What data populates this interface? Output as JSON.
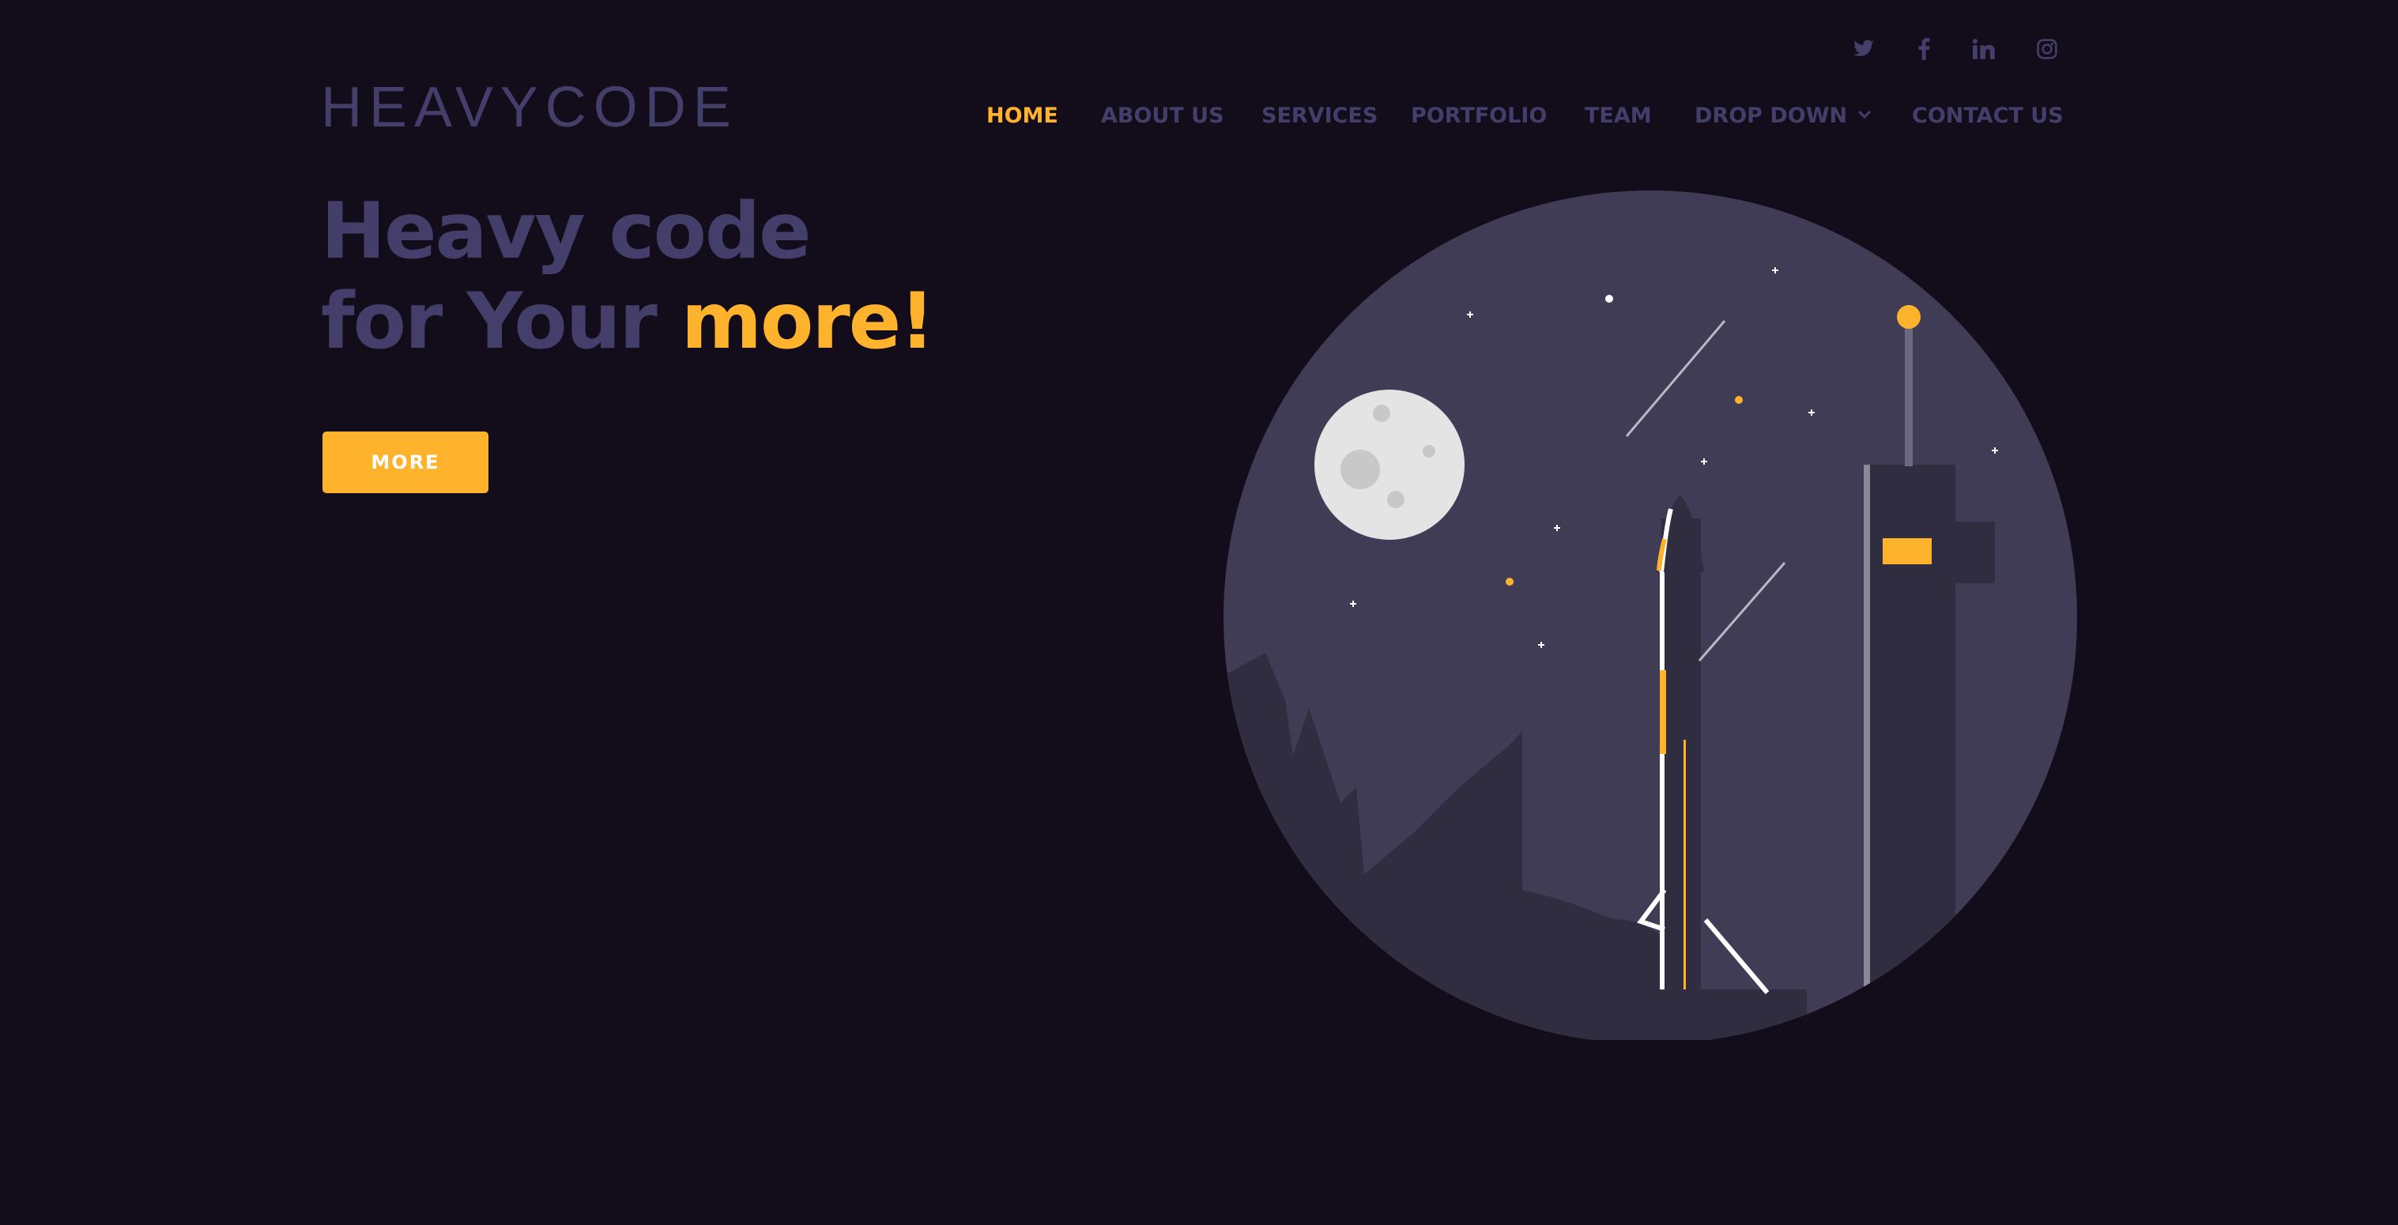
{
  "colors": {
    "background": "#120c1b",
    "muted": "#443f6a",
    "accent": "#ffb22c",
    "circle": "#403c56",
    "ground": "#302d40",
    "moon": "#e4e4e4"
  },
  "social": [
    {
      "icon": "twitter-icon"
    },
    {
      "icon": "facebook-icon"
    },
    {
      "icon": "linkedin-icon"
    },
    {
      "icon": "instagram-icon"
    }
  ],
  "brand": {
    "logo": "HEAVYCODE"
  },
  "nav": {
    "items": [
      {
        "label": "HOME",
        "active": true
      },
      {
        "label": "ABOUT US"
      },
      {
        "label": "SERVICES"
      },
      {
        "label": "PORTFOLIO"
      },
      {
        "label": "TEAM"
      },
      {
        "label": "DROP DOWN",
        "icon": "chevron-down-icon"
      },
      {
        "label": "CONTACT US"
      }
    ]
  },
  "hero": {
    "line1": "Heavy code",
    "line2_prefix": "for Your ",
    "line2_accent": "more!",
    "cta_label": "MORE"
  },
  "illustration": {
    "icon": "rocket-launch-night-illustration"
  }
}
